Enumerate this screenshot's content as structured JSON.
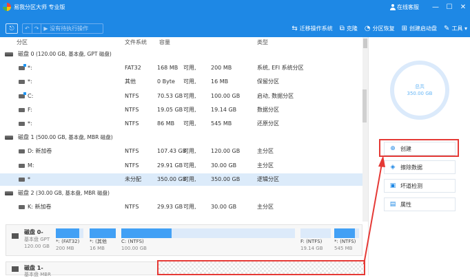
{
  "app": {
    "title": "易我分区大师 专业版",
    "user_label": "在线客服",
    "min_glyph": "—",
    "max_glyph": "☐",
    "close_glyph": "✕"
  },
  "toolbar": {
    "back_glyph": "⎋",
    "undo_glyph": "↶",
    "redo_glyph": "↷",
    "pending_label": "▶ 没有待执行操作",
    "actions": [
      {
        "icon": "⇆",
        "label": "迁移操作系统"
      },
      {
        "icon": "⧉",
        "label": "克隆"
      },
      {
        "icon": "◔",
        "label": "分区恢复"
      },
      {
        "icon": "⊞",
        "label": "创建启动盘"
      },
      {
        "icon": "✎",
        "label": "工具 ▾"
      }
    ]
  },
  "columns": {
    "partition": "分区",
    "fs": "文件系统",
    "capacity": "容量",
    "type": "类型"
  },
  "rows": [
    {
      "kind": "disk",
      "name": "磁盘 0",
      "detail": "(120.00 GB, 基本盘, GPT 磁盘)"
    },
    {
      "kind": "part",
      "sys": true,
      "name": "*:",
      "fs": "FAT32",
      "total": "168 MB",
      "sep": "可用,",
      "free": "200 MB",
      "type": "系统, EFI 系统分区"
    },
    {
      "kind": "part",
      "sys": false,
      "name": "*:",
      "fs": "其他",
      "total": "0 Byte",
      "sep": "可用,",
      "free": "16 MB",
      "type": "保留分区"
    },
    {
      "kind": "part",
      "sys": true,
      "name": "C:",
      "fs": "NTFS",
      "total": "70.53 GB",
      "sep": "可用,",
      "free": "100.00 GB",
      "type": "启动, 数据分区"
    },
    {
      "kind": "part",
      "sys": false,
      "name": "F:",
      "fs": "NTFS",
      "total": "19.05 GB",
      "sep": "可用,",
      "free": "19.14 GB",
      "type": "数据分区"
    },
    {
      "kind": "part",
      "sys": false,
      "name": "*:",
      "fs": "NTFS",
      "total": "86 MB",
      "sep": "可用,",
      "free": "545 MB",
      "type": "还原分区"
    },
    {
      "kind": "disk",
      "name": "磁盘 1",
      "detail": "(500.00 GB, 基本盘, MBR 磁盘)"
    },
    {
      "kind": "part",
      "sys": false,
      "name": "D: 新加卷",
      "fs": "NTFS",
      "total": "107.43 GB",
      "sep": "可用,",
      "free": "120.00 GB",
      "type": "主分区"
    },
    {
      "kind": "part",
      "sys": false,
      "name": "M:",
      "fs": "NTFS",
      "total": "29.91 GB",
      "sep": "可用,",
      "free": "30.00 GB",
      "type": "主分区"
    },
    {
      "kind": "part",
      "sys": false,
      "selected": true,
      "name": "*",
      "fs": "未分配",
      "total": "350.00 GB",
      "sep": "可用,",
      "free": "350.00 GB",
      "type": "逻辑分区"
    },
    {
      "kind": "disk",
      "name": "磁盘 2",
      "detail": "(30.00 GB, 基本盘, MBR 磁盘)"
    },
    {
      "kind": "part",
      "sys": false,
      "name": "K: 新加卷",
      "fs": "NTFS",
      "total": "29.93 GB",
      "sep": "可用,",
      "free": "30.00 GB",
      "type": "主分区"
    }
  ],
  "diskmap": {
    "disk0": {
      "name": "磁盘 0-",
      "l2": "基本盘 GPT",
      "l3": "120.00 GB"
    },
    "segments": [
      {
        "label": "*: (FAT32)",
        "size": "200 MB",
        "fill": 0.84
      },
      {
        "label": "*: (其他",
        "size": "16 MB",
        "fill": 1.0
      },
      {
        "label": "C: (NTFS)",
        "size": "100.00 GB",
        "fill": 0.29
      },
      {
        "label": "F: (NTFS)",
        "size": "19.14 GB",
        "fill": 0.0
      },
      {
        "label": "*: (NTFS)",
        "size": "545 MB",
        "fill": 0.84
      }
    ],
    "disk1": {
      "name": "磁盘 1-",
      "l2": "基本盘 MBR"
    }
  },
  "panel": {
    "total_label": "总共",
    "total_value": "350.00 GB",
    "buttons": [
      {
        "icon": "⊕",
        "label": "创建"
      },
      {
        "icon": "◈",
        "label": "擦除数据"
      },
      {
        "icon": "▣",
        "label": "坏道检测"
      },
      {
        "icon": "▤",
        "label": "属性"
      }
    ]
  }
}
